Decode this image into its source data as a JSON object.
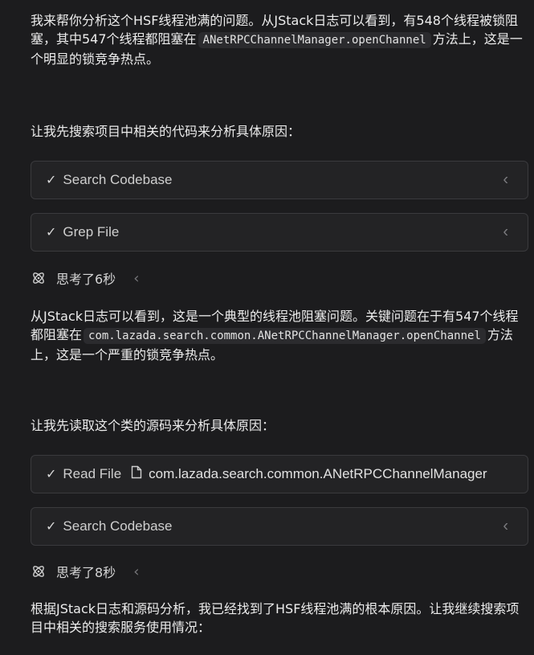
{
  "messages": {
    "p1": {
      "before": "我来帮你分析这个HSF线程池满的问题。从JStack日志可以看到，有548个线程被锁阻塞，其中547个线程都阻塞在",
      "code": "ANetRPCChannelManager.openChannel",
      "after": "方法上，这是一个明显的锁竞争热点。"
    },
    "p2": "让我先搜索项目中相关的代码来分析具体原因：",
    "p3": {
      "before": "从JStack日志可以看到，这是一个典型的线程池阻塞问题。关键问题在于有547个线程都阻塞在",
      "code": "com.lazada.search.common.ANetRPCChannelManager.openChannel",
      "after": "方法上，这是一个严重的锁竞争热点。"
    },
    "p4": "让我先读取这个类的源码来分析具体原因：",
    "p5": "根据JStack日志和源码分析，我已经找到了HSF线程池满的根本原因。让我继续搜索项目中相关的搜索服务使用情况："
  },
  "tools": {
    "search1": {
      "check": "✓",
      "label": "Search Codebase"
    },
    "grep": {
      "check": "✓",
      "label": "Grep File"
    },
    "read": {
      "check": "✓",
      "label": "Read File",
      "path": "com.lazada.search.common.ANetRPCChannelManager"
    },
    "search2": {
      "check": "✓",
      "label": "Search Codebase"
    }
  },
  "thinking": {
    "t1": "思考了6秒",
    "t2": "思考了8秒"
  },
  "icons": {
    "chevron": "‹",
    "thinking": "atom-icon",
    "file": "file-icon"
  }
}
